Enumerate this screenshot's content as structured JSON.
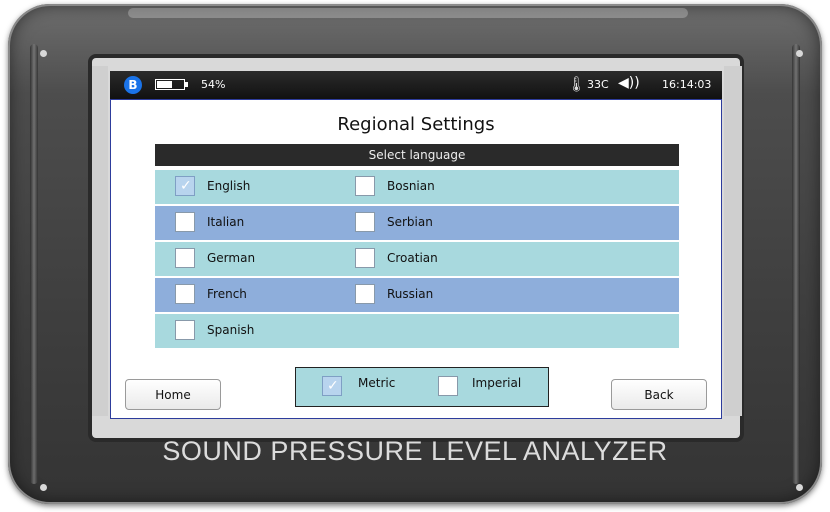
{
  "status_bar": {
    "bluetooth_icon": "B",
    "battery_percent": "54%",
    "temperature": "33C",
    "speaker_icon": "◀))",
    "thermometer_icon": "🌡",
    "time": "16:14:03"
  },
  "screen": {
    "title": "Regional Settings",
    "section_header": "Select language",
    "languages": [
      {
        "label": "English",
        "checked": true
      },
      {
        "label": "Bosnian",
        "checked": false
      },
      {
        "label": "Italian",
        "checked": false
      },
      {
        "label": "Serbian",
        "checked": false
      },
      {
        "label": "German",
        "checked": false
      },
      {
        "label": "Croatian",
        "checked": false
      },
      {
        "label": "French",
        "checked": false
      },
      {
        "label": "Russian",
        "checked": false
      },
      {
        "label": "Spanish",
        "checked": false
      }
    ],
    "units": {
      "metric_label": "Metric",
      "metric_checked": true,
      "imperial_label": "Imperial",
      "imperial_checked": false
    },
    "home_label": "Home",
    "back_label": "Back"
  },
  "device": {
    "brand_label": "SOUND PRESSURE LEVEL ANALYZER"
  },
  "colors": {
    "row_light": "#a8d9de",
    "row_dark": "#8eaedb",
    "header_bar": "#2a2a2a",
    "screen_border": "#2d3c9c"
  }
}
